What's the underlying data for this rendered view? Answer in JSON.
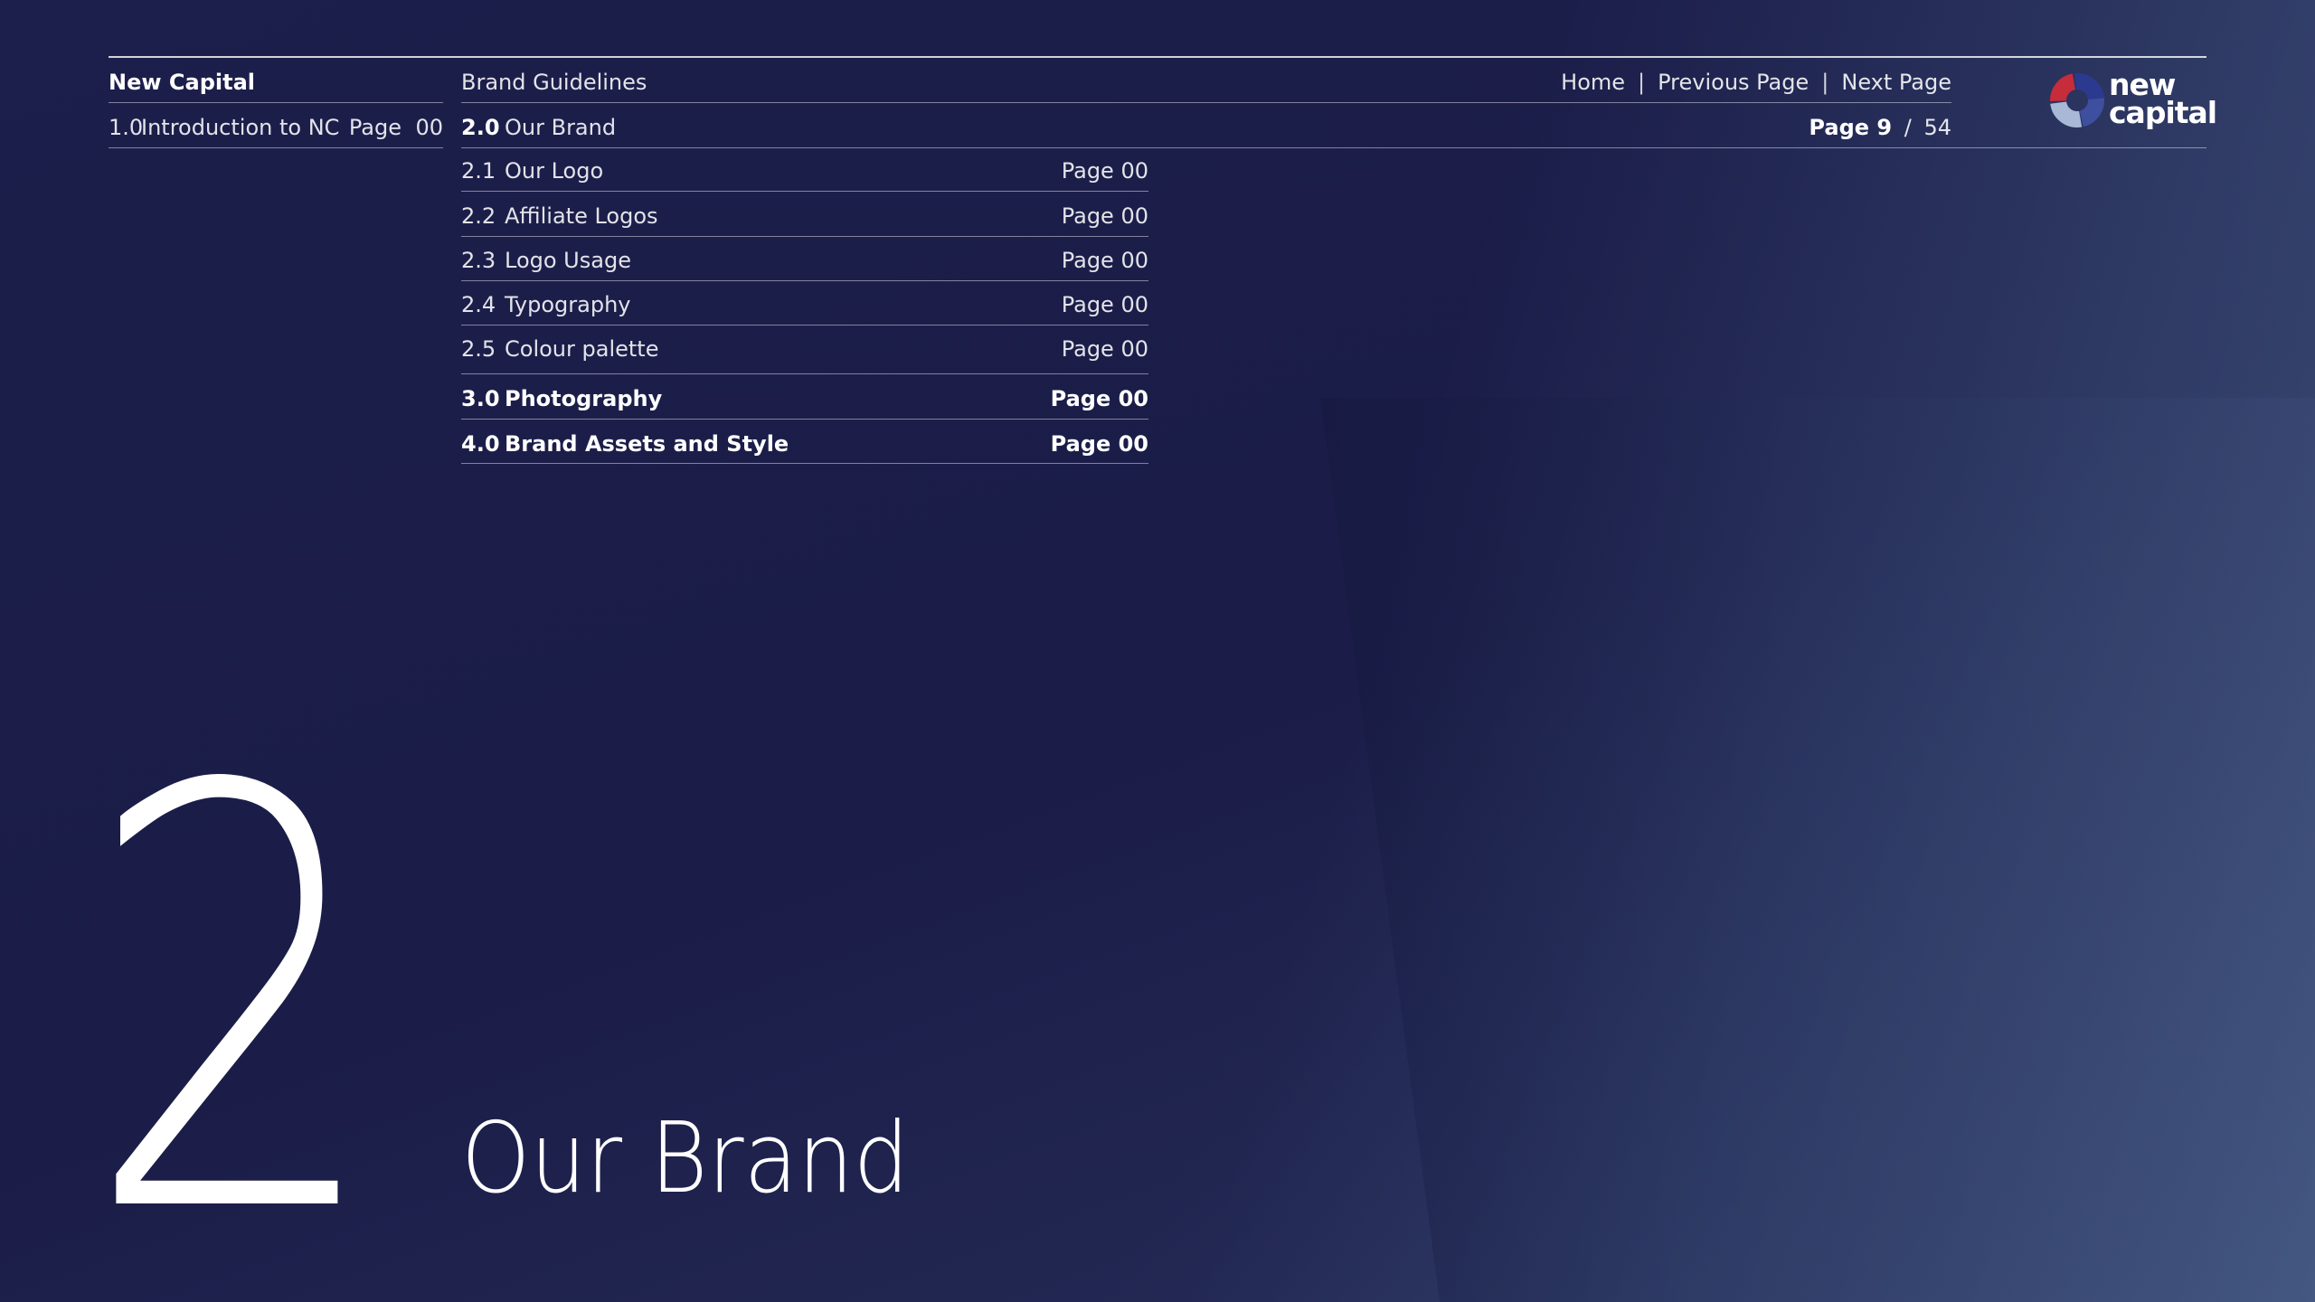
{
  "header": {
    "company": "New Capital",
    "doc_title": "Brand Guidelines",
    "nav": [
      "Home",
      "Previous Page",
      "Next Page"
    ],
    "page_current": "Page 9",
    "page_separator": "/",
    "page_total": "54"
  },
  "logo": {
    "line1": "new",
    "line2": "capital",
    "colors": [
      "#2b3a8f",
      "#c72c3b",
      "#a9b8d6",
      "#3d4f9e"
    ]
  },
  "sidebar": {
    "item_num": "1.0",
    "item_label": "Introduction to NC",
    "item_page_label": "Page",
    "item_page": "00"
  },
  "toc": {
    "current": {
      "num": "2.0",
      "label": "Our Brand"
    },
    "items": [
      {
        "num": "2.1",
        "label": "Our Logo",
        "page": "Page 00"
      },
      {
        "num": "2.2",
        "label": "Affiliate Logos",
        "page": "Page 00"
      },
      {
        "num": "2.3",
        "label": "Logo Usage",
        "page": "Page 00"
      },
      {
        "num": "2.4",
        "label": "Typography",
        "page": "Page 00"
      },
      {
        "num": "2.5",
        "label": "Colour palette",
        "page": "Page 00"
      },
      {
        "num": "3.0",
        "label": "Photography",
        "page": "Page 00"
      },
      {
        "num": "4.0",
        "label": "Brand Assets and Style",
        "page": "Page 00"
      }
    ]
  },
  "hero": {
    "number": "2",
    "title": "Our Brand"
  },
  "colors": {
    "background": "#1b1d48",
    "text": "#ffffff"
  }
}
